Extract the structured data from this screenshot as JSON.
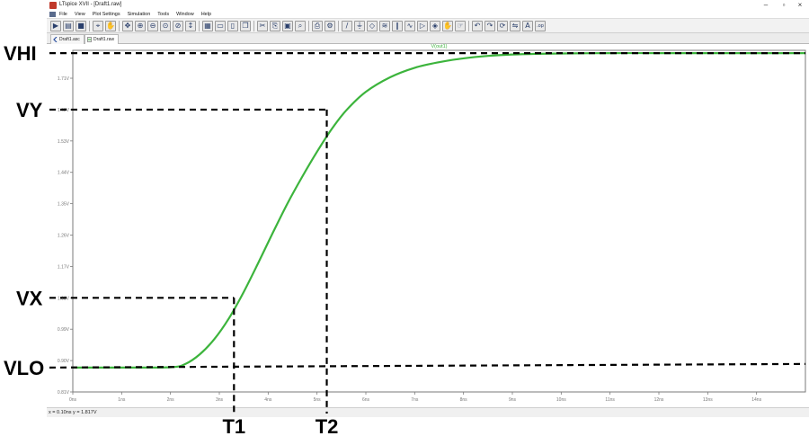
{
  "window": {
    "title": "LTspice XVII - [Draft1.raw]",
    "controls": [
      "–",
      "▫",
      "×"
    ]
  },
  "menubar": {
    "items": [
      "File",
      "View",
      "Plot Settings",
      "Simulation",
      "Tools",
      "Window",
      "Help"
    ]
  },
  "toolbar": {
    "icons": [
      "run-icon",
      "open-icon",
      "save-icon",
      "probe-icon",
      "halt-icon",
      "pan-icon",
      "zoom-in-icon",
      "zoom-out-icon",
      "zoom-fit-icon",
      "zoom-cancel-icon",
      "autorange-icon",
      "grid-icon",
      "tile-horizontal-icon",
      "tile-vertical-icon",
      "cascade-icon",
      "cut-icon",
      "copy-icon",
      "paste-icon",
      "find-icon",
      "print-icon",
      "print-setup-icon",
      "wire-icon",
      "ground-icon",
      "label-icon",
      "resistor-icon",
      "capacitor-icon",
      "inductor-icon",
      "diode-icon",
      "component-icon",
      "move-icon",
      "drag-icon",
      "undo-icon",
      "redo-icon",
      "rotate-icon",
      "mirror-icon",
      "text-icon",
      "spice-directive-icon"
    ]
  },
  "tabs": [
    {
      "label": "Draft1.asc",
      "active": false
    },
    {
      "label": "Draft1.raw",
      "active": true
    }
  ],
  "status": {
    "text": "x = 0.10ns   y = 1.817V"
  },
  "chart_data": {
    "type": "line",
    "title": "V(out1)",
    "xlabel": "",
    "ylabel": "",
    "xlim": [
      0,
      15
    ],
    "ylim": [
      0.81,
      1.79
    ],
    "x_unit": "ns",
    "x_ticks": [
      "0ns",
      "1ns",
      "2ns",
      "3ns",
      "4ns",
      "5ns",
      "6ns",
      "7ns",
      "8ns",
      "9ns",
      "10ns",
      "11ns",
      "12ns",
      "13ns",
      "14ns"
    ],
    "x_tick_values": [
      0,
      1,
      2,
      3,
      4,
      5,
      6,
      7,
      8,
      9,
      10,
      11,
      12,
      13,
      14
    ],
    "y_ticks": [
      "0.81V",
      "0.90V",
      "0.99V",
      "1.08V",
      "1.17V",
      "1.26V",
      "1.35V",
      "1.44V",
      "1.53V",
      "1.62V",
      "1.71V"
    ],
    "y_tick_values": [
      0.81,
      0.9,
      0.99,
      1.08,
      1.17,
      1.26,
      1.35,
      1.44,
      1.53,
      1.62,
      1.71
    ],
    "grid": false,
    "series": [
      {
        "name": "V(out1)",
        "color": "#3cb43c",
        "x": [
          0,
          1,
          2,
          2.3,
          2.6,
          2.9,
          3.2,
          3.5,
          3.8,
          4.1,
          4.4,
          4.7,
          5.0,
          5.3,
          5.6,
          6.0,
          6.5,
          7.0,
          7.5,
          8.0,
          8.5,
          9.0,
          9.5,
          10.0,
          11.0,
          12.0,
          13.0,
          14.0,
          15.0
        ],
        "y": [
          0.88,
          0.88,
          0.881,
          0.89,
          0.918,
          0.962,
          1.022,
          1.097,
          1.181,
          1.268,
          1.352,
          1.428,
          1.499,
          1.564,
          1.618,
          1.671,
          1.713,
          1.74,
          1.756,
          1.767,
          1.774,
          1.778,
          1.78,
          1.781,
          1.782,
          1.782,
          1.782,
          1.782,
          1.782
        ]
      }
    ]
  },
  "annotations": {
    "labels": {
      "vhi": "VHI",
      "vy": "VY",
      "vx": "VX",
      "vlo": "VLO",
      "t1": "T1",
      "t2": "T2"
    },
    "points": {
      "vhi": {
        "y": 1.782
      },
      "vy": {
        "x": 5.2,
        "y": 1.62
      },
      "vx": {
        "x": 3.3,
        "y": 1.08
      },
      "vlo": {
        "y": 0.88
      }
    }
  }
}
